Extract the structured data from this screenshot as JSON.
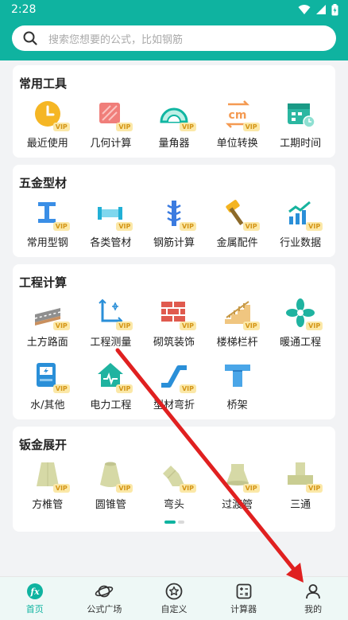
{
  "status": {
    "time": "2:28"
  },
  "search": {
    "placeholder": "搜索您想要的公式，比如钢筋"
  },
  "sections": [
    {
      "title": "常用工具",
      "items": [
        {
          "label": "最近使用",
          "icon": "clock-icon"
        },
        {
          "label": "几何计算",
          "icon": "geometry-icon"
        },
        {
          "label": "量角器",
          "icon": "protractor-icon"
        },
        {
          "label": "单位转换",
          "icon": "unit-convert-icon"
        },
        {
          "label": "工期时间",
          "icon": "calendar-icon"
        }
      ]
    },
    {
      "title": "五金型材",
      "items": [
        {
          "label": "常用型钢",
          "icon": "ibeam-icon"
        },
        {
          "label": "各类管材",
          "icon": "pipe-icon"
        },
        {
          "label": "钢筋计算",
          "icon": "rebar-icon"
        },
        {
          "label": "金属配件",
          "icon": "hammer-icon"
        },
        {
          "label": "行业数据",
          "icon": "chart-icon"
        }
      ]
    },
    {
      "title": "工程计算",
      "items": [
        {
          "label": "土方路面",
          "icon": "road-icon"
        },
        {
          "label": "工程测量",
          "icon": "measure-icon"
        },
        {
          "label": "砌筑装饰",
          "icon": "brick-icon"
        },
        {
          "label": "楼梯栏杆",
          "icon": "stairs-icon"
        },
        {
          "label": "暖通工程",
          "icon": "fan-icon"
        },
        {
          "label": "水/其他",
          "icon": "meter-icon"
        },
        {
          "label": "电力工程",
          "icon": "power-house-icon"
        },
        {
          "label": "型材弯折",
          "icon": "bend-icon"
        },
        {
          "label": "桥架",
          "icon": "tray-icon"
        }
      ]
    },
    {
      "title": "钣金展开",
      "items": [
        {
          "label": "方椎管",
          "icon": "square-cone-icon"
        },
        {
          "label": "圆锥管",
          "icon": "round-cone-icon"
        },
        {
          "label": "弯头",
          "icon": "elbow-icon"
        },
        {
          "label": "过渡管",
          "icon": "transition-icon"
        },
        {
          "label": "三通",
          "icon": "tee-icon"
        }
      ]
    }
  ],
  "vip_badge": "VIP",
  "nav": [
    {
      "label": "首页",
      "icon": "fx-home-icon",
      "active": true
    },
    {
      "label": "公式广场",
      "icon": "planet-icon",
      "active": false
    },
    {
      "label": "自定义",
      "icon": "star-circle-icon",
      "active": false
    },
    {
      "label": "计算器",
      "icon": "calculator-icon",
      "active": false
    },
    {
      "label": "我的",
      "icon": "user-icon",
      "active": false
    }
  ],
  "colors": {
    "accent": "#0fb3a0",
    "vip_text": "#d49516",
    "vip_bg": "#fbe8a8",
    "arrow": "#e02020"
  }
}
